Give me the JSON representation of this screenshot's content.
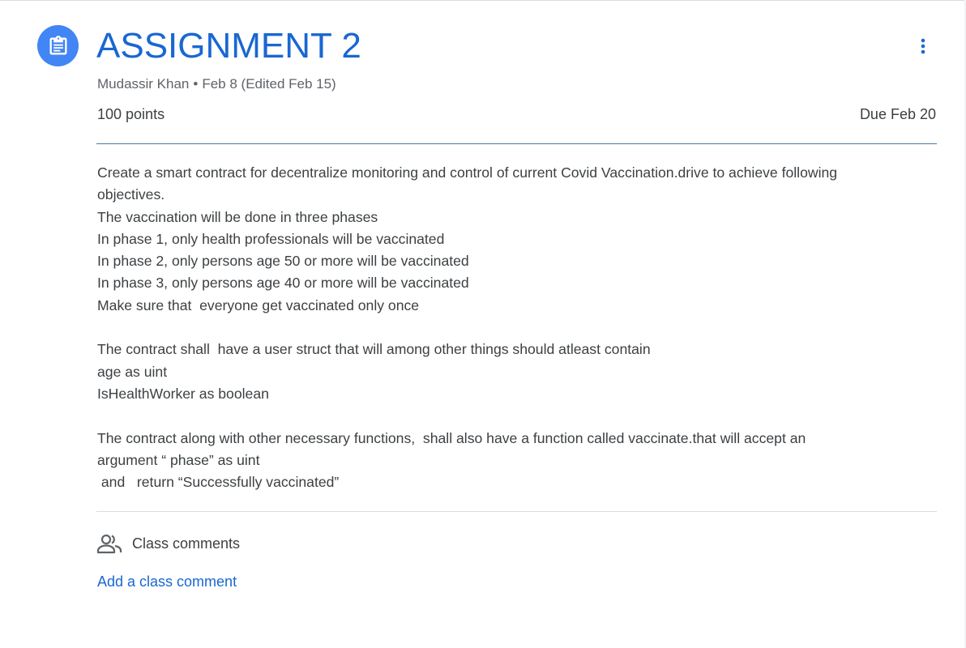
{
  "assignment": {
    "title": "ASSIGNMENT 2",
    "author": "Mudassir Khan",
    "separator": "•",
    "date": "Feb 8 (Edited Feb 15)",
    "points": "100 points",
    "due": "Due Feb 20",
    "icon": "assignment-icon",
    "accent_color": "#1967d2",
    "icon_bg_color": "#4285f4"
  },
  "description": {
    "lines": [
      "Create a smart contract for decentralize monitoring and control of current Covid Vaccination.drive to achieve following",
      "objectives.",
      "The vaccination will be done in three phases",
      "In phase 1, only health professionals will be vaccinated",
      "In phase 2, only persons age 50 or more will be vaccinated",
      "In phase 3, only persons age 40 or more will be vaccinated",
      "Make sure that  everyone get vaccinated only once",
      "",
      "The contract shall  have a user struct that will among other things should atleast contain",
      "age as uint",
      "IsHealthWorker as boolean",
      "",
      "The contract along with other necessary functions,  shall also have a function called vaccinate.that will accept an",
      "argument “ phase” as uint",
      " and   return “Successfully vaccinated”"
    ]
  },
  "comments": {
    "header": "Class comments",
    "icon": "people-icon",
    "add_label": "Add a class comment"
  },
  "menu": {
    "icon": "more-vert-icon"
  }
}
